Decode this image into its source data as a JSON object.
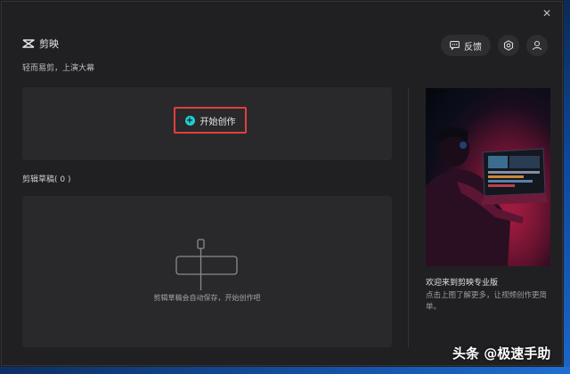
{
  "app": {
    "name": "剪映",
    "slogan": "轻而易剪，上演大幕",
    "close_icon": "close-icon",
    "logo_icon": "capcut-logo-icon"
  },
  "header": {
    "feedback_label": "反馈",
    "feedback_icon": "chat-bubble-icon",
    "settings_icon": "gear-icon",
    "account_icon": "user-icon"
  },
  "start": {
    "label": "开始创作",
    "icon": "plus-circle-icon",
    "accent": "#1ecfd6",
    "highlight": "#e0403a"
  },
  "drafts": {
    "title": "剪辑草稿( 0 )",
    "empty_text": "剪辑草稿会自动保存，开始创作吧",
    "empty_icon": "empty-draft-icon"
  },
  "promo": {
    "title": "欢迎来到剪映专业版",
    "desc": "点击上图了解更多，让视频创作更简单。"
  },
  "watermark": {
    "text": "头条 @极速手助"
  }
}
